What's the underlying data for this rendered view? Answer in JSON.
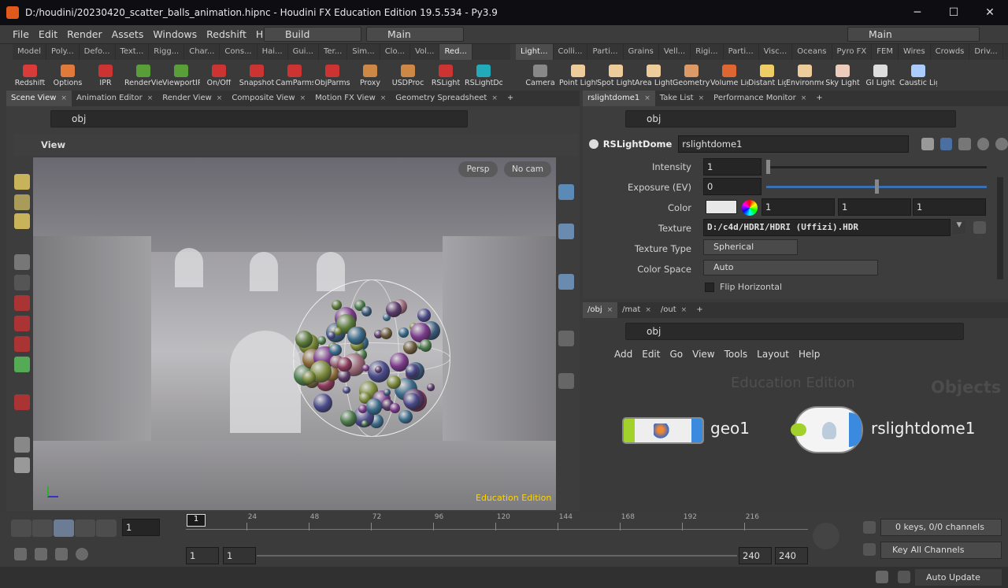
{
  "window": {
    "title": "D:/houdini/20230420_scatter_balls_animation.hipnc - Houdini FX Education Edition 19.5.534 - Py3.9",
    "minimize": "─",
    "maximize": "☐",
    "close": "✕"
  },
  "menu": {
    "items": [
      "File",
      "Edit",
      "Render",
      "Assets",
      "Windows",
      "Redshift",
      "Help"
    ],
    "desktop": "Build",
    "view": "Main",
    "right_desktop": "Main"
  },
  "shelf_tabs_left": [
    "Model",
    "Poly...",
    "Defo...",
    "Text...",
    "Rigg...",
    "Char...",
    "Cons...",
    "Hai...",
    "Gui...",
    "Ter...",
    "Sim...",
    "Clo...",
    "Vol...",
    "Red..."
  ],
  "shelf_tabs_right": [
    "Light...",
    "Colli...",
    "Parti...",
    "Grains",
    "Vell...",
    "Rigi...",
    "Parti...",
    "Visc...",
    "Oceans",
    "Pyro FX",
    "FEM",
    "Wires",
    "Crowds",
    "Driv..."
  ],
  "shelf_tools_left": [
    {
      "label": "Redshift",
      "color": "#d93a3a"
    },
    {
      "label": "Options",
      "color": "#e07a3a"
    },
    {
      "label": "IPR",
      "color": "#c33"
    },
    {
      "label": "RenderView",
      "color": "#5a9e3a"
    },
    {
      "label": "ViewportIPR",
      "color": "#5a9e3a"
    },
    {
      "label": "On/Off",
      "color": "#c33"
    },
    {
      "label": "Snapshot",
      "color": "#c33"
    },
    {
      "label": "CamParms",
      "color": "#c33"
    },
    {
      "label": "ObjParms",
      "color": "#c33"
    },
    {
      "label": "Proxy",
      "color": "#c84"
    },
    {
      "label": "USDProc",
      "color": "#c84"
    },
    {
      "label": "RSLight",
      "color": "#c33"
    },
    {
      "label": "RSLightDo",
      "color": "#2ab"
    }
  ],
  "shelf_tools_right": [
    {
      "label": "Camera",
      "color": "#888"
    },
    {
      "label": "Point Light",
      "color": "#ec9"
    },
    {
      "label": "Spot Light",
      "color": "#ec9"
    },
    {
      "label": "Area Light",
      "color": "#ec9"
    },
    {
      "label": "Geometry Light",
      "color": "#d96"
    },
    {
      "label": "Volume Light",
      "color": "#d63"
    },
    {
      "label": "Distant Light",
      "color": "#ec6"
    },
    {
      "label": "Environment Light",
      "color": "#ec9"
    },
    {
      "label": "Sky Light",
      "color": "#ecb"
    },
    {
      "label": "GI Light",
      "color": "#ddd"
    },
    {
      "label": "Caustic Light",
      "color": "#acf"
    }
  ],
  "left_pane": {
    "tabs": [
      "Scene View",
      "Animation Editor",
      "Render View",
      "Composite View",
      "Motion FX View",
      "Geometry Spreadsheet"
    ],
    "path": "obj",
    "view_label": "View",
    "persp": "Persp",
    "cam": "No cam",
    "watermark": "Education Edition"
  },
  "param_pane": {
    "tabs": [
      "rslightdome1",
      "Take List",
      "Performance Monitor"
    ],
    "path": "obj",
    "node_type": "RSLightDome",
    "node_name": "rslightdome1",
    "params": {
      "intensity_label": "Intensity",
      "intensity": "1",
      "exposure_label": "Exposure (EV)",
      "exposure": "0",
      "color_label": "Color",
      "color": [
        "1",
        "1",
        "1"
      ],
      "texture_label": "Texture",
      "texture": "D:/c4d/HDRI/HDRI (Uffizi).HDR",
      "textype_label": "Texture Type",
      "textype": "Spherical",
      "colorspace_label": "Color Space",
      "colorspace": "Auto",
      "flip_label": "Flip Horizontal"
    },
    "intensity_level": 0.0,
    "exposure_level": 0.5
  },
  "network": {
    "tabs": [
      "/obj",
      "/mat",
      "/out"
    ],
    "path": "obj",
    "menu": [
      "Add",
      "Edit",
      "Go",
      "View",
      "Tools",
      "Layout",
      "Help"
    ],
    "watermark": "Education Edition",
    "context": "Objects",
    "nodes": [
      {
        "name": "geo1"
      },
      {
        "name": "rslightdome1"
      }
    ]
  },
  "timeline": {
    "frame": "1",
    "ticks": [
      "1",
      "24",
      "48",
      "72",
      "96",
      "120",
      "144",
      "168",
      "192",
      "216"
    ],
    "start": "1",
    "start2": "1",
    "end": "240",
    "end2": "240",
    "keys": "0 keys, 0/0 channels",
    "channels": "Key All Channels",
    "update": "Auto Update"
  }
}
